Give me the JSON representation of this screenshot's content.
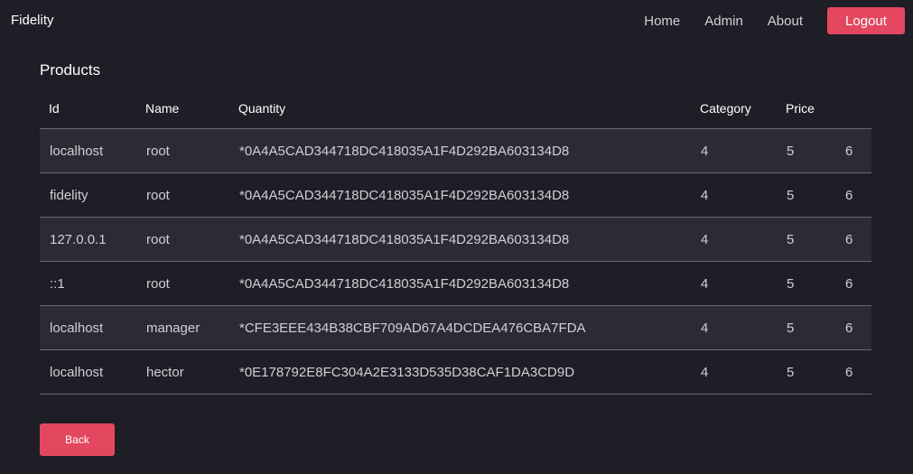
{
  "navbar": {
    "brand": "Fidelity",
    "links": [
      "Home",
      "Admin",
      "About"
    ],
    "logout_label": "Logout"
  },
  "page": {
    "title": "Products",
    "back_label": "Back"
  },
  "table": {
    "headers": [
      "Id",
      "Name",
      "Quantity",
      "Category",
      "Price",
      ""
    ],
    "rows": [
      [
        "localhost",
        "root",
        "*0A4A5CAD344718DC418035A1F4D292BA603134D8",
        "4",
        "5",
        "6"
      ],
      [
        "fidelity",
        "root",
        "*0A4A5CAD344718DC418035A1F4D292BA603134D8",
        "4",
        "5",
        "6"
      ],
      [
        "127.0.0.1",
        "root",
        "*0A4A5CAD344718DC418035A1F4D292BA603134D8",
        "4",
        "5",
        "6"
      ],
      [
        "::1",
        "root",
        "*0A4A5CAD344718DC418035A1F4D292BA603134D8",
        "4",
        "5",
        "6"
      ],
      [
        "localhost",
        "manager",
        "*CFE3EEE434B38CBF709AD67A4DCDEA476CBA7FDA",
        "4",
        "5",
        "6"
      ],
      [
        "localhost",
        "hector",
        "*0E178792E8FC304A2E3133D535D38CAF1DA3CD9D",
        "4",
        "5",
        "6"
      ]
    ]
  },
  "colors": {
    "background": "#1e1e26",
    "accent": "#e2475f",
    "row_stripe": "#2b2b34"
  }
}
